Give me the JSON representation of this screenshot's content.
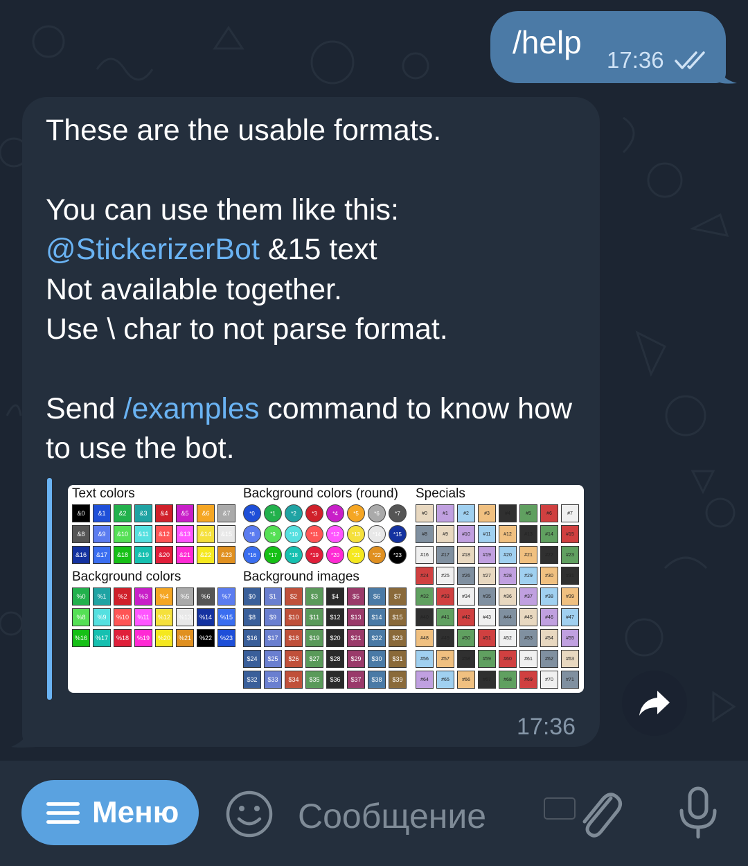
{
  "outgoing": {
    "text": "/help",
    "time": "17:36",
    "status_icon": "double-check-icon"
  },
  "incoming": {
    "line1": "These are the usable formats.",
    "line2": "You can use them like this:",
    "mention": "@StickerizerBot",
    "mention_suffix": " &15 text",
    "line4": "Not available together.",
    "line5": "Use \\ char to not parse format.",
    "send_prefix": "Send ",
    "command": "/examples",
    "send_suffix": " command to know how to use the bot.",
    "time": "17:36"
  },
  "preview": {
    "text_colors_title": "Text colors",
    "bg_round_title": "Background colors (round)",
    "specials_title": "Specials",
    "bg_colors_title": "Background colors",
    "bg_images_title": "Background images",
    "text_colors": [
      "&0",
      "&1",
      "&2",
      "&3",
      "&4",
      "&5",
      "&6",
      "&7",
      "&8",
      "&9",
      "&10",
      "&11",
      "&12",
      "&13",
      "&14",
      "&15",
      "&16",
      "&17",
      "&18",
      "&19",
      "&20",
      "&21",
      "&22",
      "&23"
    ],
    "round_colors": [
      "*0",
      "*1",
      "*2",
      "*3",
      "*4",
      "*5",
      "*6",
      "*7",
      "*8",
      "*9",
      "*10",
      "*11",
      "*12",
      "*13",
      "*14",
      "*15",
      "*16",
      "*17",
      "*18",
      "*19",
      "*20",
      "*21",
      "*22",
      "*23"
    ],
    "bg_colors": [
      "%0",
      "%1",
      "%2",
      "%3",
      "%4",
      "%5",
      "%6",
      "%7",
      "%8",
      "%9",
      "%10",
      "%11",
      "%12",
      "%13",
      "%14",
      "%15",
      "%16",
      "%17",
      "%18",
      "%19",
      "%20",
      "%21",
      "%22",
      "%23"
    ],
    "bg_images": [
      "$0",
      "$1",
      "$2",
      "$3",
      "$4",
      "$5",
      "$6",
      "$7",
      "$8",
      "$9",
      "$10",
      "$11",
      "$12",
      "$13",
      "$14",
      "$15",
      "$16",
      "$17",
      "$18",
      "$19",
      "$20",
      "$21",
      "$22",
      "$23",
      "$24",
      "$25",
      "$26",
      "$27",
      "$28",
      "$29",
      "$30",
      "$31",
      "$32",
      "$33",
      "$34",
      "$35",
      "$36",
      "$37",
      "$38",
      "$39"
    ],
    "specials": [
      "#0",
      "#1",
      "#2",
      "#3",
      "#4",
      "#5",
      "#6",
      "#7",
      "#8",
      "#9",
      "#10",
      "#11",
      "#12",
      "#13",
      "#14",
      "#15",
      "#16",
      "#17",
      "#18",
      "#19",
      "#20",
      "#21",
      "#22",
      "#23",
      "#24",
      "#25",
      "#26",
      "#27",
      "#28",
      "#29",
      "#30",
      "#31",
      "#32",
      "#33",
      "#34",
      "#35",
      "#36",
      "#37",
      "#38",
      "#39",
      "#40",
      "#41",
      "#42",
      "#43",
      "#44",
      "#45",
      "#46",
      "#47",
      "#48",
      "#49",
      "#50",
      "#51",
      "#52",
      "#53",
      "#54",
      "#55",
      "#56",
      "#57",
      "#58",
      "#59",
      "#60",
      "#61",
      "#62",
      "#63",
      "#64",
      "#65",
      "#66",
      "#67",
      "#68",
      "#69",
      "#70",
      "#71"
    ],
    "palette": [
      "#000000",
      "#1e4fd8",
      "#22b14c",
      "#1fa3a3",
      "#d0202a",
      "#c81fc8",
      "#f5a623",
      "#aaaaaa",
      "#555555",
      "#5b7cf0",
      "#55e055",
      "#55e0e0",
      "#ff5555",
      "#ff55ff",
      "#f5e03c",
      "#e8e8e8",
      "#1432a0",
      "#3a6ef0",
      "#16c016",
      "#16c0b0",
      "#e01f3a",
      "#ff2ad4",
      "#f5e81f",
      "#e09020"
    ]
  },
  "input": {
    "menu_label": "Меню",
    "placeholder": "Сообщение"
  }
}
